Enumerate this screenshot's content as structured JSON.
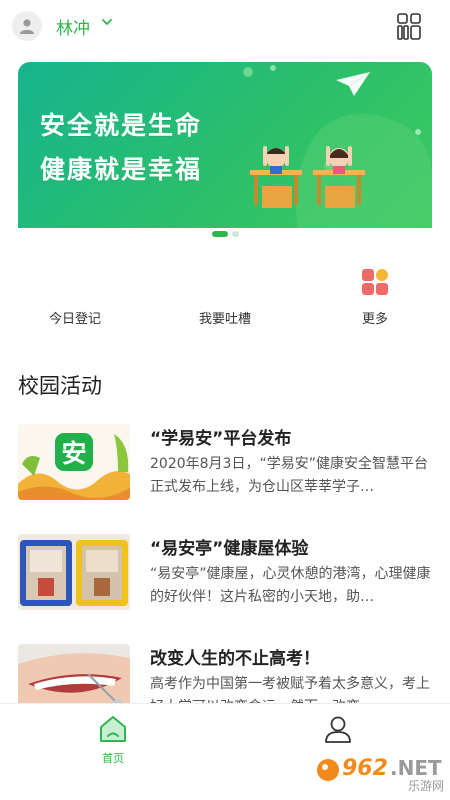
{
  "header": {
    "user_name": "林冲",
    "icons": {
      "avatar": "user-avatar-icon",
      "dropdown": "chevron-down-icon",
      "menu": "grid-menu-icon"
    }
  },
  "banner": {
    "line1": "安全就是生命",
    "line2": "健康就是幸福",
    "active_slide": 1,
    "slide_count": 2
  },
  "quick_menu": [
    {
      "label": "今日登记"
    },
    {
      "label": "我要吐槽"
    },
    {
      "label": "更多"
    }
  ],
  "section": {
    "title": "校园活动"
  },
  "articles": [
    {
      "title": "“学易安”平台发布",
      "desc": "2020年8月3日，“学易安”健康安全智慧平台正式发布上线，为仓山区莘莘学子…",
      "thumb_char": "安"
    },
    {
      "title": "“易安亭”健康屋体验",
      "desc": "“易安亭”健康屋，心灵休憩的港湾，心理健康的好伙伴！这片私密的小天地，助…"
    },
    {
      "title": "改变人生的不止高考！",
      "desc": "高考作为中国第一考被赋予着太多意义，考上好大学可以改变命运，然而，改变…"
    }
  ],
  "tabbar": {
    "home_label": "首页"
  },
  "watermark": {
    "number": "962",
    "net": ".NET",
    "cn": "乐游网"
  },
  "colors": {
    "accent": "#2db84d"
  }
}
